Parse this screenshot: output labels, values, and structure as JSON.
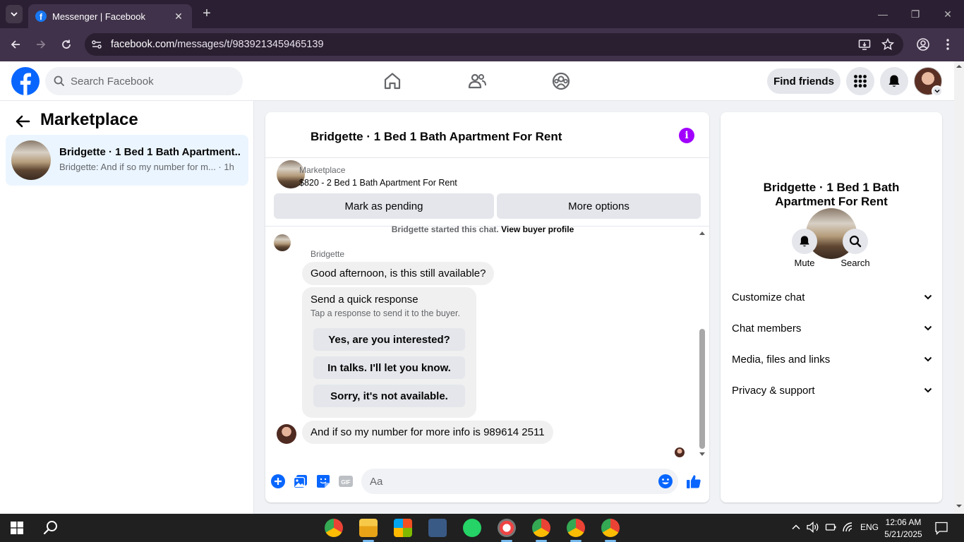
{
  "browser": {
    "tab_title": "Messenger | Facebook",
    "url_host": "facebook.com",
    "url_path": "/messages/t/9839213459465139",
    "new_tab_symbol": "+",
    "tab_close_symbol": "✕",
    "window_controls": [
      "—",
      "❐",
      "✕"
    ]
  },
  "header": {
    "search_placeholder": "Search Facebook",
    "find_friends": "Find friends"
  },
  "left_panel": {
    "title": "Marketplace",
    "conversation": {
      "name": "Bridgette · 1 Bed 1 Bath Apartment...",
      "preview": "Bridgette: And if so my number for m... · 1h"
    }
  },
  "chat": {
    "title": "Bridgette · 1 Bed 1 Bath Apartment For Rent",
    "marketplace_label": "Marketplace",
    "listing": "$820 - 2 Bed 1 Bath Apartment For Rent",
    "mark_pending": "Mark as pending",
    "more_options": "More options",
    "started_text": "Bridgette started this chat.",
    "view_profile": "View buyer profile",
    "sender_name": "Bridgette",
    "message1": "Good afternoon, is this still available?",
    "quick_title": "Send a quick response",
    "quick_sub": "Tap a response to send it to the buyer.",
    "quick_options": [
      "Yes, are you interested?",
      "In talks. I'll let you know.",
      "Sorry, it's not available."
    ],
    "message2": "And if so my number for more info is 989614 2511",
    "composer_placeholder": "Aa"
  },
  "right_panel": {
    "name": "Bridgette · 1 Bed 1 Bath Apartment For Rent",
    "mute": "Mute",
    "search": "Search",
    "sections": [
      "Customize chat",
      "Chat members",
      "Media, files and links",
      "Privacy & support"
    ]
  },
  "taskbar": {
    "language": "ENG",
    "time": "12:06 AM",
    "date": "5/21/2025"
  },
  "colors": {
    "facebook_blue": "#0866ff",
    "messenger_purple": "#a100ff",
    "selected_row": "#ebf5ff"
  }
}
